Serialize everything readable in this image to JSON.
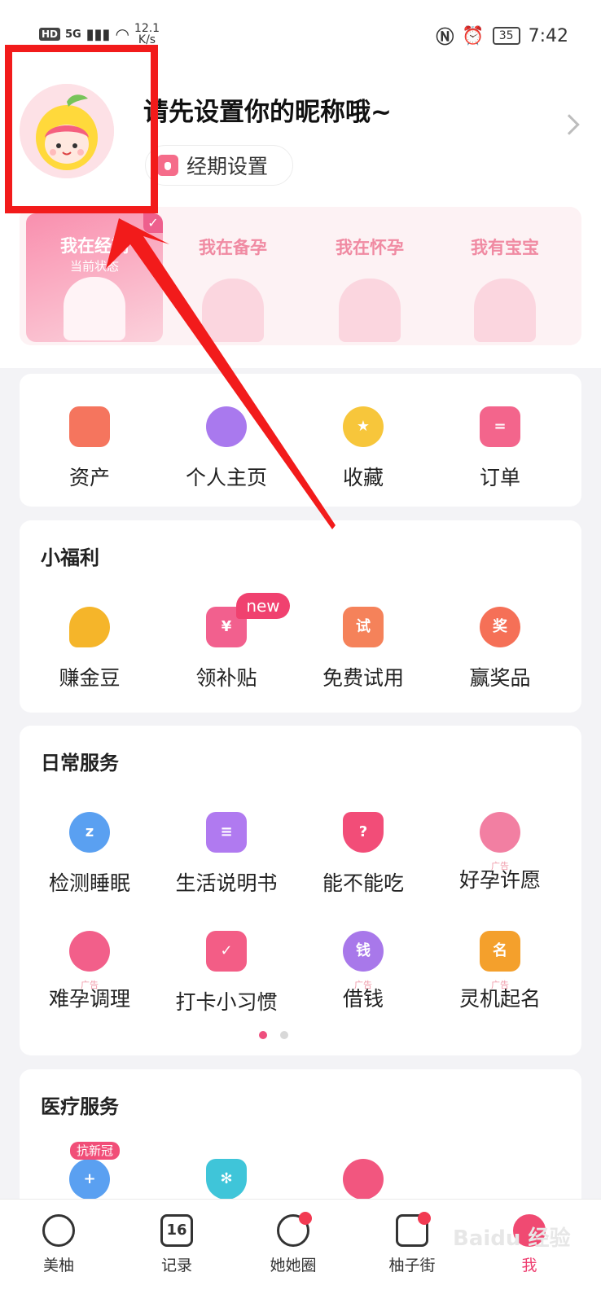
{
  "statusbar": {
    "left_tags": [
      "HD",
      "5G"
    ],
    "speed": "12.1",
    "speed_unit": "K/s",
    "battery": "35",
    "time": "7:42"
  },
  "profile": {
    "nickname_prompt": "请先设置你的昵称哦~",
    "period_button": "经期设置"
  },
  "status_cards": [
    {
      "label": "我在经期",
      "sub": "当前状态",
      "active": true
    },
    {
      "label": "我在备孕"
    },
    {
      "label": "我在怀孕"
    },
    {
      "label": "我有宝宝"
    }
  ],
  "quick": [
    {
      "label": "资产",
      "icon": "wallet-icon",
      "color": "#f5755e"
    },
    {
      "label": "个人主页",
      "icon": "person-icon",
      "color": "#a979ee"
    },
    {
      "label": "收藏",
      "icon": "star-icon",
      "color": "#f7c63b"
    },
    {
      "label": "订单",
      "icon": "order-icon",
      "color": "#f3658c"
    }
  ],
  "welfare": {
    "title": "小福利",
    "new_badge": "new",
    "items": [
      {
        "label": "赚金豆",
        "icon": "bean-icon",
        "color": "#f5b52a"
      },
      {
        "label": "领补贴",
        "icon": "yen-icon",
        "color": "#f2608e",
        "glyph": "¥"
      },
      {
        "label": "免费试用",
        "icon": "trial-bag-icon",
        "color": "#f5825a",
        "glyph": "试"
      },
      {
        "label": "赢奖品",
        "icon": "prize-flame-icon",
        "color": "#f57057",
        "glyph": "奖"
      }
    ]
  },
  "daily": {
    "title": "日常服务",
    "items": [
      {
        "label": "检测睡眠",
        "icon": "sleep-moon-icon",
        "color": "#5aa0f1",
        "glyph": "z"
      },
      {
        "label": "生活说明书",
        "icon": "manual-book-icon",
        "color": "#b07af0"
      },
      {
        "label": "能不能吃",
        "icon": "bowl-icon",
        "color": "#f24d78",
        "glyph": "?"
      },
      {
        "label": "好孕许愿",
        "icon": "wish-icon",
        "color": "#f27fa2",
        "ad": "广告"
      },
      {
        "label": "难孕调理",
        "icon": "herb-pot-icon",
        "color": "#f25f8a",
        "ad": "广告"
      },
      {
        "label": "打卡小习惯",
        "icon": "checkin-calendar-icon",
        "color": "#f35d86"
      },
      {
        "label": "借钱",
        "icon": "money-bag-icon",
        "color": "#a878ea",
        "glyph": "钱",
        "ad": "广告"
      },
      {
        "label": "灵机起名",
        "icon": "naming-book-icon",
        "color": "#f4a02c",
        "glyph": "名",
        "ad": "广告"
      }
    ]
  },
  "medical": {
    "title": "医疗服务",
    "anti_badge": "抗新冠",
    "items": [
      {
        "icon": "medical-chat-icon",
        "color": "#5aa0f1"
      },
      {
        "icon": "shield-virus-icon",
        "color": "#3fc5d9"
      },
      {
        "icon": "vaccine-syringe-icon",
        "color": "#f2567f"
      }
    ]
  },
  "tabs": [
    {
      "label": "美柚",
      "icon": "grapefruit-icon"
    },
    {
      "label": "记录",
      "icon": "calendar-16-icon",
      "glyph": "16"
    },
    {
      "label": "她她圈",
      "icon": "community-icon",
      "dot": true
    },
    {
      "label": "柚子街",
      "icon": "shop-bag-icon",
      "dot": true
    },
    {
      "label": "我",
      "icon": "me-icon",
      "active": true
    }
  ],
  "watermark": "Baidu 经验"
}
